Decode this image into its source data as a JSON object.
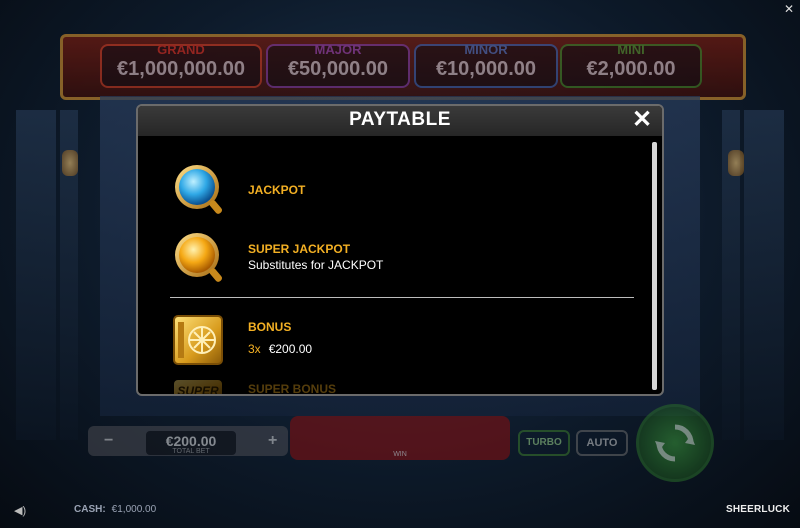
{
  "jackpots": [
    {
      "name": "GRAND",
      "value": "€1,000,000.00",
      "color": "#d0302a"
    },
    {
      "name": "MAJOR",
      "value": "€50,000.00",
      "color": "#8d48c8"
    },
    {
      "name": "MINOR",
      "value": "€10,000.00",
      "color": "#3a7ad6"
    },
    {
      "name": "MINI",
      "value": "€2,000.00",
      "color": "#3aa23a"
    }
  ],
  "paytable": {
    "title": "PAYTABLE",
    "close_symbol": "✕",
    "items": [
      {
        "icon": "jackpot-blue-coin-icon",
        "name": "JACKPOT",
        "desc": ""
      },
      {
        "icon": "super-jackpot-gold-coin-icon",
        "name": "SUPER JACKPOT",
        "desc": "Substitutes for JACKPOT"
      },
      {
        "icon": "bonus-vault-icon",
        "name": "BONUS",
        "multiplier": "3x",
        "amount": "€200.00"
      },
      {
        "icon": "super-bonus-icon",
        "name": "SUPER BONUS"
      }
    ]
  },
  "controls": {
    "bet_value": "€200.00",
    "bet_label": "TOTAL BET",
    "minus": "−",
    "plus": "+",
    "win_label": "WIN",
    "turbo": "TURBO",
    "auto": "AUTO",
    "win_info": "WIN"
  },
  "footer": {
    "cash_label": "CASH:",
    "cash_value": "€1,000.00",
    "brand": "SHEERLUCK",
    "corner_close": "✕"
  }
}
